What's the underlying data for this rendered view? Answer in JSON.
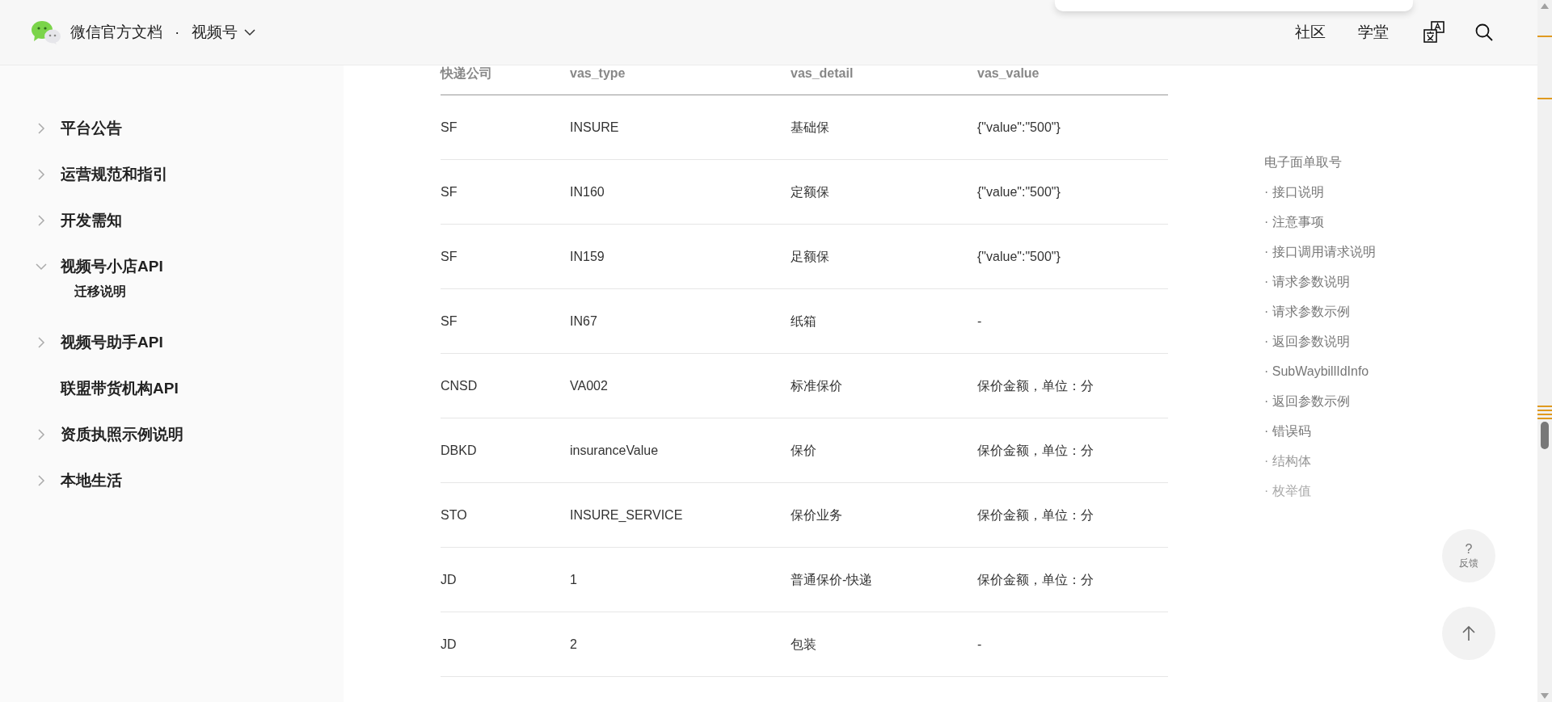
{
  "header": {
    "site_title": "微信官方文档",
    "separator": "·",
    "section": "视频号",
    "nav_links": [
      "社区",
      "学堂"
    ]
  },
  "sidebar": {
    "items": [
      {
        "label": "平台公告",
        "kind": "group",
        "expanded": false
      },
      {
        "label": "运营规范和指引",
        "kind": "group",
        "expanded": false
      },
      {
        "label": "开发需知",
        "kind": "group",
        "expanded": false
      },
      {
        "label": "视频号小店API",
        "kind": "group",
        "expanded": true,
        "children": [
          {
            "label": "迁移说明"
          }
        ]
      },
      {
        "label": "视频号助手API",
        "kind": "group",
        "expanded": false
      },
      {
        "label": "联盟带货机构API",
        "kind": "link"
      },
      {
        "label": "资质执照示例说明",
        "kind": "group",
        "expanded": false
      },
      {
        "label": "本地生活",
        "kind": "group",
        "expanded": false
      }
    ]
  },
  "table": {
    "columns": [
      "快递公司",
      "vas_type",
      "vas_detail",
      "vas_value"
    ],
    "rows": [
      [
        "SF",
        "INSURE",
        "基础保",
        "{\"value\":\"500\"}"
      ],
      [
        "SF",
        "IN160",
        "定额保",
        "{\"value\":\"500\"}"
      ],
      [
        "SF",
        "IN159",
        "足额保",
        "{\"value\":\"500\"}"
      ],
      [
        "SF",
        "IN67",
        "纸箱",
        "-"
      ],
      [
        "CNSD",
        "VA002",
        "标准保价",
        "保价金额，单位：分"
      ],
      [
        "DBKD",
        "insuranceValue",
        "保价",
        "保价金额，单位：分"
      ],
      [
        "STO",
        "INSURE_SERVICE",
        "保价业务",
        "保价金额，单位：分"
      ],
      [
        "JD",
        "1",
        "普通保价-快递",
        "保价金额，单位：分"
      ],
      [
        "JD",
        "2",
        "包装",
        "-"
      ]
    ]
  },
  "toc": {
    "title": "电子面单取号",
    "items": [
      "· 接口说明",
      "· 注意事项",
      "· 接口调用请求说明",
      "· 请求参数说明",
      "· 请求参数示例",
      "· 返回参数说明",
      "· SubWaybillIdInfo",
      "· 返回参数示例",
      "· 错误码",
      "· 结构体",
      "· 枚举值"
    ]
  },
  "feedback_button": {
    "symbol": "?",
    "label": "反馈"
  }
}
